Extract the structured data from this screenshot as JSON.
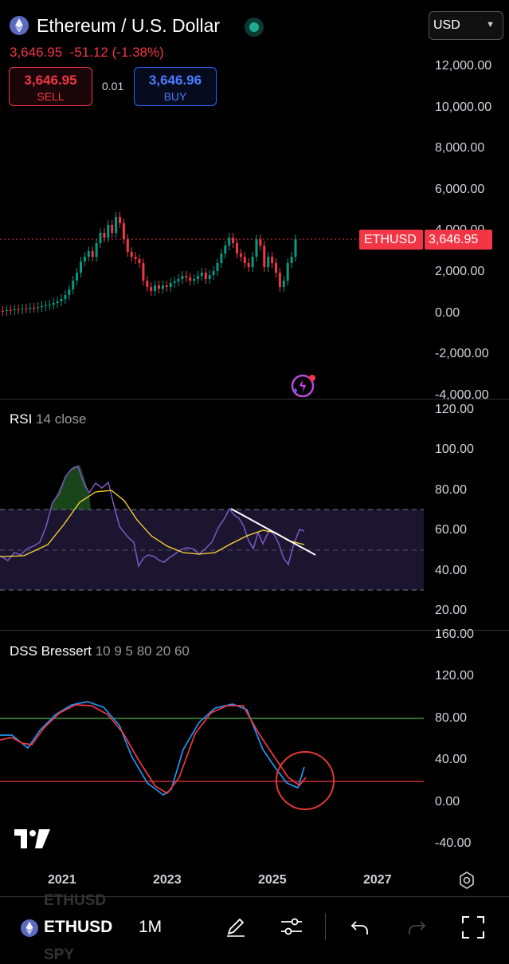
{
  "header": {
    "title": "Ethereum / U.S. Dollar",
    "price": "3,646.95",
    "change": "-51.12",
    "change_pct": "(-1.38%)",
    "sell_price": "3,646.95",
    "sell_label": "SELL",
    "spread": "0.01",
    "buy_price": "3,646.96",
    "buy_label": "BUY",
    "currency": "USD"
  },
  "colors": {
    "down": "#f23645",
    "up": "#089981",
    "buy": "#2962ff",
    "rsi": "#7e57c2",
    "rsi_ma": "#fdd835",
    "dss1": "#2196f3",
    "dss2": "#f23645",
    "line80": "#4caf50",
    "line20": "#f23645"
  },
  "price_pane": {
    "axis_labels": [
      "12,000.00",
      "10,000.00",
      "8,000.00",
      "6,000.00",
      "4,000.00",
      "2,000.00",
      "0.00",
      "-2,000.00",
      "-4,000.00"
    ],
    "symbol_tag": "ETHUSD",
    "price_tag": "3,646.95"
  },
  "rsi_pane": {
    "title": "RSI",
    "params": "14 close",
    "axis_labels": [
      "120.00",
      "100.00",
      "80.00",
      "60.00",
      "40.00",
      "20.00"
    ]
  },
  "dss_pane": {
    "title": "DSS Bressert",
    "params": "10 9 5 80 20 60",
    "axis_labels": [
      "160.00",
      "120.00",
      "80.00",
      "40.00",
      "0.00",
      "-40.00"
    ]
  },
  "time_axis": [
    "2021",
    "2023",
    "2025",
    "2027"
  ],
  "toolbar": {
    "symbol": "ETHUSD",
    "interval": "1M",
    "ghost_above": "ETHUSD",
    "ghost_below": "SPY"
  }
}
